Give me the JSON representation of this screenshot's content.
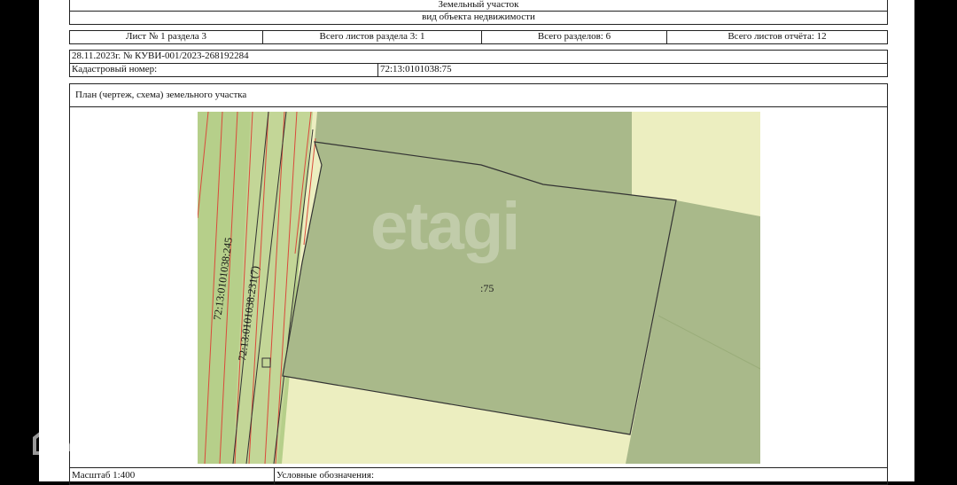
{
  "header": {
    "object_title": "Земельный участок",
    "object_subtitle": "вид объекта недвижимости"
  },
  "sheet_info": {
    "sheet": "Лист № 1 раздела 3",
    "total_sheets_section": "Всего листов раздела 3: 1",
    "total_sections": "Всего разделов: 6",
    "total_sheets_report": "Всего листов отчёта: 12"
  },
  "record": {
    "date_number": "28.11.2023г. № КУВИ-001/2023-268192284",
    "cadastral_label": "Кадастровый номер:",
    "cadastral_value": "72:13:0101038:75"
  },
  "plan": {
    "title": "План (чертеж, схема) земельного участка",
    "parcel_label": ":75",
    "label_parcel_245": "72:13:0101038:245",
    "label_parcel_231": "72:13:0101038:231(7)"
  },
  "footer": {
    "scale": "Масштаб 1:400",
    "legend": "Условные обозначения:"
  },
  "watermarks": {
    "etagi": "etagi",
    "domclick": "Домклик"
  },
  "colors": {
    "parcel_fill": "#a9b98a",
    "strip_green": "#b6cf8a",
    "light_bg": "#eceec0",
    "boundary_red": "#d94a3a"
  }
}
